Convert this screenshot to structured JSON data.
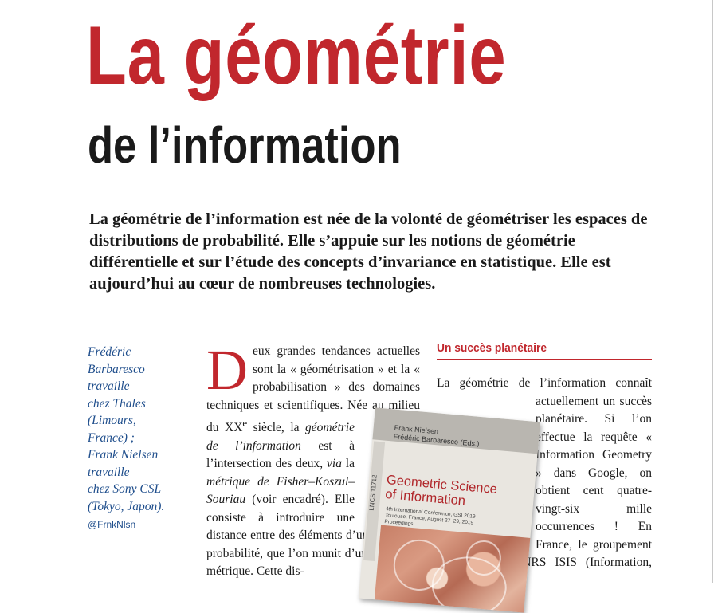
{
  "title": "La géométrie",
  "subtitle": "de l’information",
  "lead": "La géométrie de l’information est née de la volonté de géométriser les espaces de distributions de probabilité. Elle s’appuie sur les notions de géométrie différentielle et sur l’étude des concepts d’invariance en statistique. Elle est aujourd’hui au cœur de nombreuses technologies.",
  "authors": {
    "lines": [
      "Frédéric",
      "Barbaresco",
      "travaille",
      "chez Thales",
      "(Limours,",
      "France) ;",
      "Frank Nielsen",
      "travaille",
      "chez Sony CSL",
      "(Tokyo, Japon)."
    ],
    "handle": "@FrnkNlsn"
  },
  "column1": {
    "dropcap": "D",
    "p1_a": "eux grandes tendances actuelles sont la « géométrisation » et la « probabilisation » des domaines techniques et scientifiques. Née au milieu du XX",
    "p1_sup": "e",
    "p1_b": " siècle, la ",
    "p1_em1": "géométrie de l’information",
    "p1_c": " est à l’intersection des deux, ",
    "p1_em2": "via",
    "p1_d": " la ",
    "p1_em3": "métrique de Fisher–Koszul–Souriau",
    "p1_e": " (voir encadré). Elle consiste à introduire une distance entre des éléments d’un espace de probabilité, que l’on munit d’une structure métrique. Cette dis-"
  },
  "column2": {
    "section_title": "Un succès planétaire",
    "p1": "La géométrie de l’information connaît actuellement un succès planétaire. Si l’on effectue la requête « Information Geometry » dans Google, on obtient cent quatre-vingt-six mille occurrences ! En France, le groupement de recherche CNRS ISIS (Information, signal,"
  },
  "book": {
    "editor1": "Frank Nielsen",
    "editor2": "Frédéric Barbaresco (Eds.)",
    "series": "LNCS 11712",
    "title_line1": "Geometric Science",
    "title_line2": "of Information",
    "sub1": "4th International Conference, GSI 2019",
    "sub2": "Toulouse, France, August 27–29, 2019",
    "sub3": "Proceedings"
  }
}
